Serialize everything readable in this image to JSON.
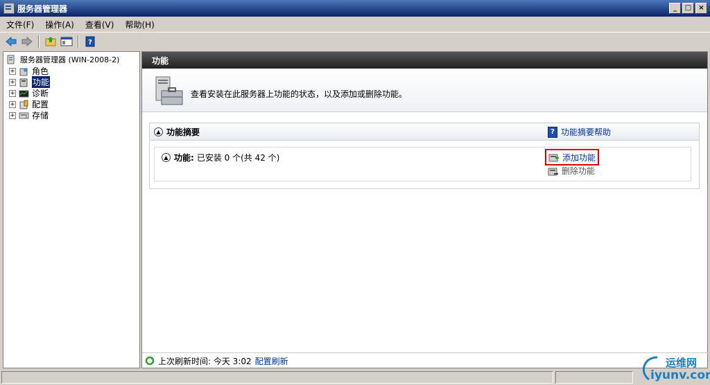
{
  "window": {
    "title": "服务器管理器",
    "buttons": [
      "_",
      "□",
      "×"
    ]
  },
  "menu": [
    "文件(F)",
    "操作(A)",
    "查看(V)",
    "帮助(H)"
  ],
  "tree": {
    "root": "服务器管理器 (WIN-2008-2)",
    "items": [
      {
        "label": "角色",
        "icon": "roles-icon"
      },
      {
        "label": "功能",
        "icon": "features-icon",
        "selected": true
      },
      {
        "label": "诊断",
        "icon": "diagnostics-icon"
      },
      {
        "label": "配置",
        "icon": "configuration-icon"
      },
      {
        "label": "存储",
        "icon": "storage-icon"
      }
    ]
  },
  "panel": {
    "header": "功能",
    "description": "查看安装在此服务器上功能的状态，以及添加或删除功能。"
  },
  "summary": {
    "title": "功能摘要",
    "help_link": "功能摘要帮助",
    "features_label": "功能:",
    "features_status": "已安装 0 个(共 42 个)",
    "add_action": "添加功能",
    "remove_action": "删除功能"
  },
  "status": {
    "last_refresh_label": "上次刷新时间: 今天 3:02",
    "configure_refresh": "配置刷新"
  },
  "watermark": {
    "line1": "运维网",
    "line2": "iyunv.com"
  },
  "colors": {
    "selection": "#0a246a",
    "link": "#0033a0",
    "highlight_border": "#e00000",
    "header_bg": "#333333"
  }
}
